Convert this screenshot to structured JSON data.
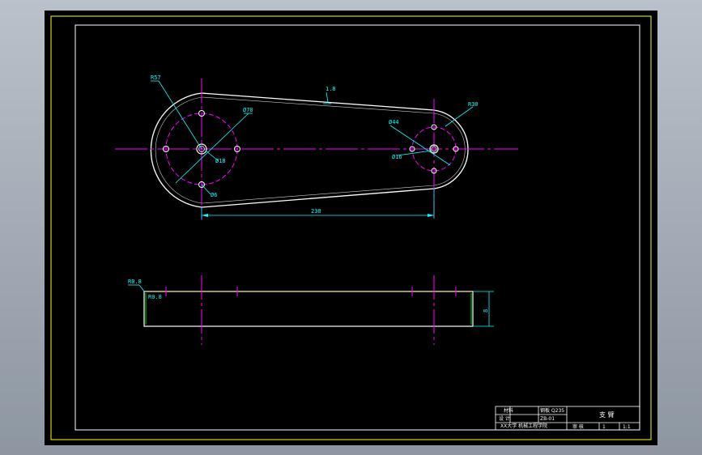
{
  "colors": {
    "outline": "#ffffff",
    "centerline": "#ff00ff",
    "dimension": "#00ffff",
    "section_line": "#ffff88",
    "border_outer": "#ffff00",
    "border_inner": "#ffffff",
    "hidden": "#00ff00"
  },
  "dimensions": {
    "top_left_radius": "R57",
    "dia_70": "Ø70",
    "dia_18": "Ø18",
    "hole_4x": "Ø6",
    "draft": "1.8",
    "right_radius": "R30",
    "dia_44": "Ø44",
    "dia_16": "Ø16",
    "center_distance": "230",
    "fillet_outer": "R0.8",
    "fillet_inner": "R0.8",
    "thickness": "8"
  },
  "title_block": {
    "part_name": "支 臂",
    "material_label": "材料",
    "material_value": "钢板 Q235",
    "designer": "设 计",
    "checker": "审 核",
    "scale_label": "比例",
    "scale_value": "1:1",
    "qty_label": "件数",
    "qty_value": "1",
    "drawing_no": "ZB-01",
    "school": "XX大学 机械工程学院"
  }
}
